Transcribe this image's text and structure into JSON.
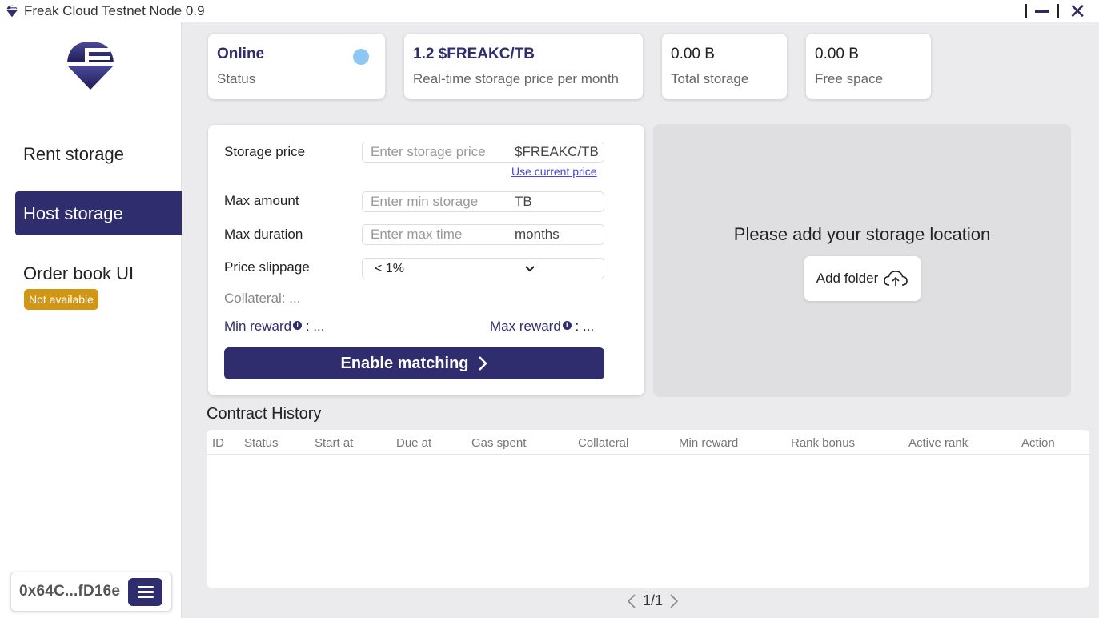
{
  "window": {
    "title": "Freak Cloud Testnet Node 0.9"
  },
  "sidebar": {
    "items": [
      {
        "label": "Rent storage"
      },
      {
        "label": "Host storage"
      },
      {
        "label": "Order book UI"
      }
    ],
    "badge": "Not available",
    "wallet": {
      "address": "0x64C...fD16e"
    }
  },
  "stats": {
    "status": {
      "value": "Online",
      "label": "Status"
    },
    "price": {
      "value": "1.2 $FREAKC/TB",
      "label": "Real-time storage price per month"
    },
    "total": {
      "value": "0.00 B",
      "label": "Total storage"
    },
    "free": {
      "value": "0.00 B",
      "label": "Free space"
    }
  },
  "form": {
    "storage_price": {
      "label": "Storage price",
      "placeholder": "Enter storage price",
      "unit": "$FREAKC/TB",
      "link": "Use current price"
    },
    "max_amount": {
      "label": "Max amount",
      "placeholder": "Enter min storage",
      "unit": "TB"
    },
    "max_duration": {
      "label": "Max duration",
      "placeholder": "Enter max time",
      "unit": "months"
    },
    "slippage": {
      "label": "Price slippage",
      "selected": "< 1%"
    },
    "collateral": "Collateral: ...",
    "min_reward": {
      "label": "Min reward",
      "value": ": ..."
    },
    "max_reward": {
      "label": "Max reward",
      "value": ": ..."
    },
    "enable_button": "Enable matching"
  },
  "location": {
    "message": "Please add your storage location",
    "add_folder": "Add folder"
  },
  "history": {
    "title": "Contract History",
    "columns": [
      "ID",
      "Status",
      "Start at",
      "Due at",
      "Gas spent",
      "Collateral",
      "Min reward",
      "Rank bonus",
      "Active rank",
      "Action"
    ],
    "rows": [],
    "pagination": "1/1"
  },
  "colors": {
    "accent": "#2f2d6e",
    "status_online": "#8ec7f4",
    "badge": "#d19613"
  }
}
